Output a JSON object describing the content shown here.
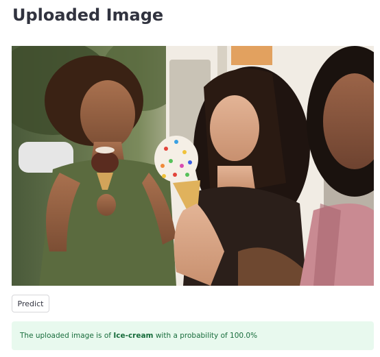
{
  "header": {
    "title": "Uploaded Image"
  },
  "image": {
    "alt": "Three women smiling and eating ice-cream cones outside an ice-cream truck"
  },
  "actions": {
    "predict_label": "Predict"
  },
  "result": {
    "prefix": "The uploaded image is of ",
    "label": "Ice-cream",
    "middle": " with a probability of ",
    "probability": "100.0%"
  },
  "theme": {
    "text_color": "#31333f",
    "success_bg": "#e8f9ee",
    "success_text": "#176c3b",
    "button_border": "#d6d6d9"
  }
}
